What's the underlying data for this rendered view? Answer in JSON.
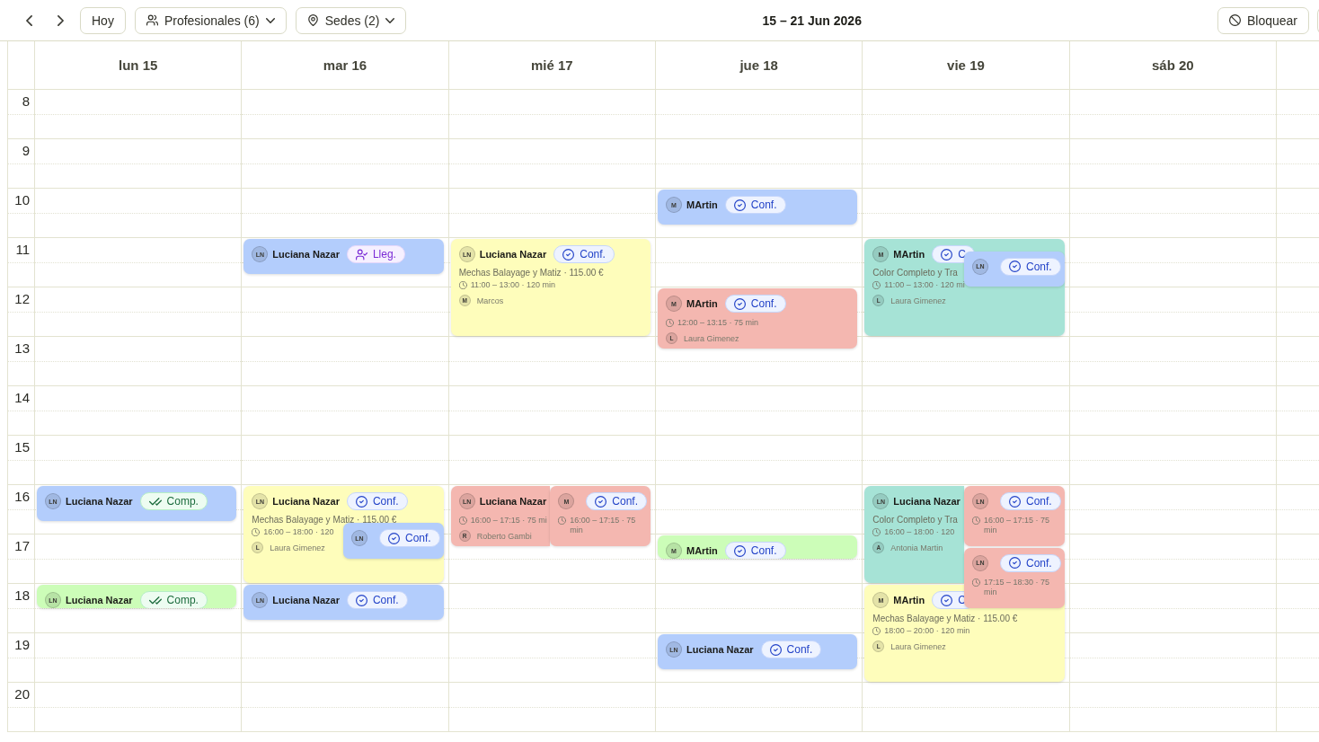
{
  "toolbar": {
    "today_button": "Hoy",
    "filters": [
      {
        "kind": "people",
        "label": "Profesionales (6)"
      },
      {
        "kind": "location",
        "label": "Sedes (2)"
      }
    ],
    "title": "15 – 21 Jun 2026",
    "block_button": "Bloquear"
  },
  "calendar": {
    "hours": [
      "8",
      "9",
      "10",
      "11",
      "12",
      "13",
      "14",
      "15",
      "16",
      "17",
      "18",
      "19",
      "20"
    ],
    "days": [
      {
        "label": "lun 15",
        "events": [
          {
            "color": "#b3cdfc",
            "avatar": "LN",
            "name": "Luciana Nazar",
            "status": {
              "kind": "completed",
              "label": "Comp."
            }
          },
          {
            "color": "#ccfdb8",
            "avatar": "LN",
            "name": "Luciana Nazar",
            "status": {
              "kind": "completed",
              "label": "Comp."
            }
          }
        ]
      },
      {
        "label": "mar 16",
        "events": [
          {
            "color": "#b3cdfc",
            "avatar": "LN",
            "name": "Luciana Nazar",
            "status": {
              "kind": "arrived",
              "label": "Lleg."
            }
          },
          {
            "color": "#fefdbb",
            "avatar": "LN",
            "name": "Luciana Nazar",
            "status": {
              "kind": "confirmed",
              "label": "Conf."
            },
            "service": "Mechas Balayage y Matiz · 115.00 €",
            "time": "16:00 – 18:00 · 120",
            "client": {
              "avatar": "L",
              "name": "Laura Gimenez"
            }
          },
          {
            "color": "#b3cdfc",
            "avatar": "LN",
            "status": {
              "kind": "confirmed",
              "label": "Conf."
            }
          },
          {
            "color": "#b3cdfc",
            "avatar": "LN",
            "name": "Luciana Nazar",
            "status": {
              "kind": "confirmed",
              "label": "Conf."
            }
          }
        ]
      },
      {
        "label": "mié 17",
        "events": [
          {
            "color": "#fefdbb",
            "avatar": "LN",
            "name": "Luciana Nazar",
            "status": {
              "kind": "confirmed",
              "label": "Conf."
            },
            "service": "Mechas Balayage y Matiz · 115.00 €",
            "time": "11:00 – 13:00 · 120 min",
            "client": {
              "avatar": "M",
              "name": "Marcos"
            }
          },
          {
            "color": "#f4b7b0",
            "avatar": "LN",
            "name": "Luciana Nazar",
            "time": "16:00 – 17:15 · 75 mi",
            "client": {
              "avatar": "R",
              "name": "Roberto Gambi"
            }
          },
          {
            "color": "#f4b7b0",
            "avatar": "M",
            "status": {
              "kind": "confirmed",
              "label": "Conf."
            },
            "time": "16:00 – 17:15 · 75 min"
          }
        ]
      },
      {
        "label": "jue 18",
        "events": [
          {
            "color": "#b3cdfc",
            "avatar": "M",
            "name": "MArtin",
            "status": {
              "kind": "confirmed",
              "label": "Conf."
            }
          },
          {
            "color": "#f4b7b0",
            "avatar": "M",
            "name": "MArtin",
            "status": {
              "kind": "confirmed",
              "label": "Conf."
            },
            "time": "12:00 – 13:15 · 75 min",
            "client": {
              "avatar": "L",
              "name": "Laura Gimenez"
            }
          },
          {
            "color": "#ccfdb8",
            "avatar": "M",
            "name": "MArtin",
            "status": {
              "kind": "confirmed",
              "label": "Conf."
            }
          },
          {
            "color": "#b3cdfc",
            "avatar": "LN",
            "name": "Luciana Nazar",
            "status": {
              "kind": "confirmed",
              "label": "Conf."
            }
          }
        ]
      },
      {
        "label": "vie 19",
        "events": [
          {
            "color": "#a6e3d6",
            "avatar": "M",
            "name": "MArtin",
            "status": {
              "kind": "confirmed",
              "label": "C"
            },
            "service": "Color Completo y Tra",
            "time": "11:00 – 13:00 · 120 mi",
            "client": {
              "avatar": "L",
              "name": "Laura Gimenez"
            }
          },
          {
            "color": "#b3cdfc",
            "avatar": "LN",
            "status": {
              "kind": "confirmed",
              "label": "Conf."
            }
          },
          {
            "color": "#a6e3d6",
            "avatar": "LN",
            "name": "Luciana Nazar",
            "service": "Color Completo y Tra",
            "time": "16:00 – 18:00 · 120",
            "client": {
              "avatar": "A",
              "name": "Antonia Martin"
            }
          },
          {
            "color": "#f4b7b0",
            "avatar": "LN",
            "status": {
              "kind": "confirmed",
              "label": "Conf."
            },
            "time": "16:00 – 17:15 · 75 min"
          },
          {
            "color": "#f4b7b0",
            "avatar": "LN",
            "status": {
              "kind": "confirmed",
              "label": "Conf."
            },
            "time": "17:15 – 18:30 · 75 min"
          },
          {
            "color": "#fefdbb",
            "avatar": "M",
            "name": "MArtin",
            "status": {
              "kind": "confirmed",
              "label": "C"
            },
            "service": "Mechas Balayage y Matiz · 115.00 €",
            "time": "18:00 – 20:00 · 120 min",
            "client": {
              "avatar": "L",
              "name": "Laura Gimenez"
            }
          }
        ]
      },
      {
        "label": "sáb 20"
      }
    ]
  }
}
